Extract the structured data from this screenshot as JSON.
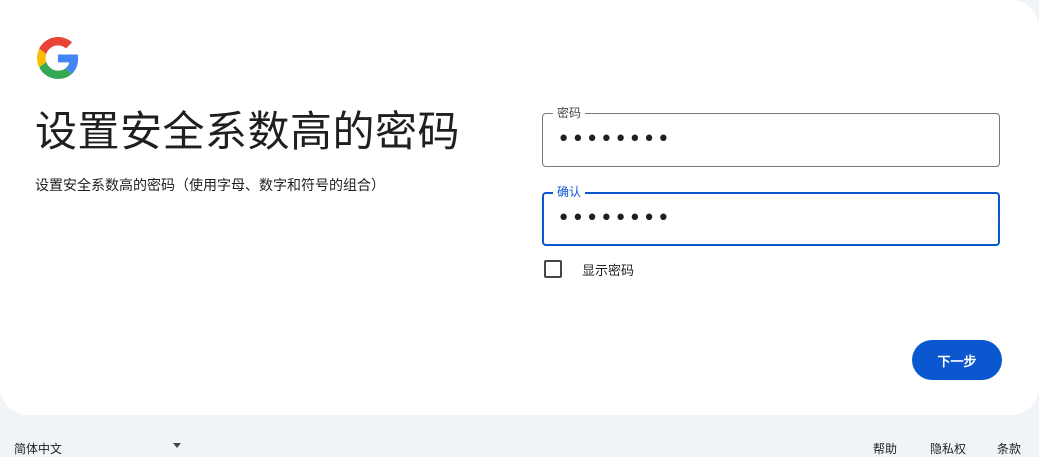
{
  "logo": {
    "icon": "google-g-icon",
    "colors": {
      "blue": "#4285F4",
      "red": "#EA4335",
      "yellow": "#FBBC05",
      "green": "#34A853"
    }
  },
  "heading": {
    "title": "设置安全系数高的密码",
    "subtitle": "设置安全系数高的密码（使用字母、数字和符号的组合）"
  },
  "form": {
    "password_label": "密码",
    "password_value": "••••••••",
    "confirm_label": "确认",
    "confirm_value": "••••••••",
    "show_password_label": "显示密码",
    "show_password_checked": false,
    "next_button": "下一步"
  },
  "footer": {
    "language": "简体中文",
    "links": {
      "help": "帮助",
      "privacy": "隐私权",
      "terms": "条款"
    }
  },
  "colors": {
    "accent": "#0b57d0",
    "page_background": "#f0f4f9",
    "card_background": "#ffffff"
  }
}
